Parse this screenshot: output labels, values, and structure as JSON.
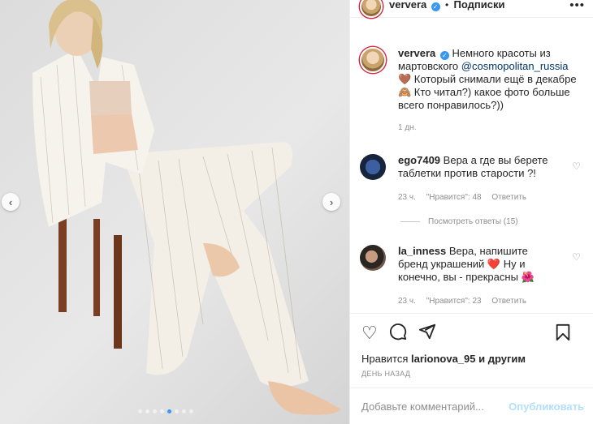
{
  "post": {
    "username": "ververa",
    "verified_icon": "verified-badge-icon",
    "separator": "•",
    "follow_label": "Подписки",
    "more_icon": "more-options-icon",
    "photo_dots_count": 8,
    "photo_active_index": 4
  },
  "caption": {
    "username": "ververa",
    "line1": "Немного красоты из мартовского",
    "mention": "@cosmopolitan_russia",
    "line2": "🤎 Который снимали ещё в декабре",
    "line3": "🙈 Кто читал?) какое фото больше всего понравилось?))",
    "time": "1 дн."
  },
  "comments": [
    {
      "username": "ego7409",
      "text": "Вера а где вы берете таблетки против старости ?!",
      "time": "23 ч.",
      "likes": "\"Нравится\": 48",
      "reply": "Ответить"
    },
    {
      "username": "la_inness",
      "text1": "Вера, напишите бренд украшений",
      "emoji1": "❤️",
      "text2": "Ну и конечно, вы - прекрасны",
      "emoji2": "🌺",
      "time": "23 ч.",
      "likes": "\"Нравится\": 23",
      "reply": "Ответить"
    }
  ],
  "view_replies": "Посмотреть ответы (15)",
  "actions": {
    "like_icon": "heart-icon",
    "comment_icon": "comment-icon",
    "share_icon": "share-icon",
    "save_icon": "bookmark-icon"
  },
  "likes": {
    "prefix": "Нравится",
    "user": "larionova_95",
    "suffix": "и другим"
  },
  "date": "ДЕНЬ НАЗАД",
  "add_comment": {
    "placeholder": "Добавьте комментарий...",
    "publish_label": "Опубликовать"
  },
  "colors": {
    "accent": "#3897f0",
    "publish_disabled": "#b2dffc",
    "meta_gray": "#8e8e8e",
    "heart_red": "#ed4956"
  }
}
